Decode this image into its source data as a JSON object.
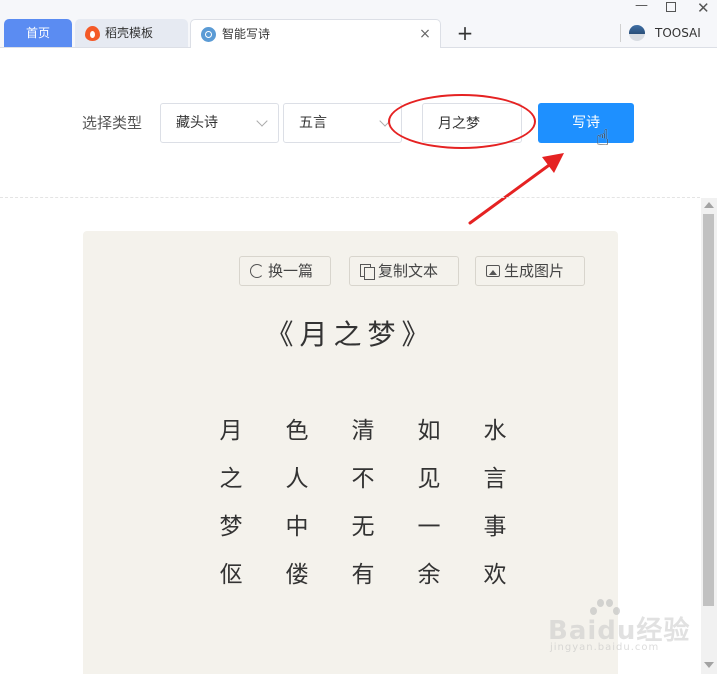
{
  "tabs": [
    {
      "label": "首页",
      "active": false
    },
    {
      "label": "稻壳模板",
      "active": false
    },
    {
      "label": "智能写诗",
      "active": true
    }
  ],
  "window": {
    "close_tab_glyph": "×",
    "new_tab_glyph": "+",
    "minimize_glyph": "—",
    "close_glyph": "✕",
    "user_name": "TOOSAI"
  },
  "form": {
    "label": "选择类型",
    "type_value": "藏头诗",
    "length_value": "五言",
    "title_value": "月之梦",
    "write_button": "写诗"
  },
  "toolbar": {
    "refresh": "换一篇",
    "copy": "复制文本",
    "image": "生成图片"
  },
  "poem": {
    "title": "《月之梦》",
    "lines": [
      [
        "月",
        "色",
        "清",
        "如",
        "水"
      ],
      [
        "之",
        "人",
        "不",
        "见",
        "言"
      ],
      [
        "梦",
        "中",
        "无",
        "一",
        "事"
      ],
      [
        "伛",
        "偻",
        "有",
        "余",
        "欢"
      ]
    ]
  },
  "watermark": {
    "brand": "Baidu经验",
    "url": "jingyan.baidu.com"
  },
  "colors": {
    "accent": "#1e90ff",
    "home_tab": "#5b8cf2",
    "annotation": "#e52222",
    "card_bg": "#f4f2ec"
  }
}
